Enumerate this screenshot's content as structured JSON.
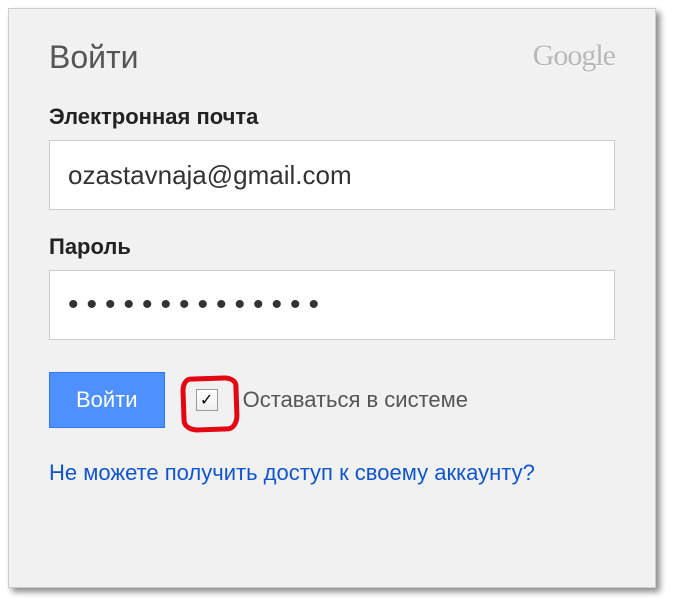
{
  "header": {
    "title": "Войти",
    "brand": "Google"
  },
  "form": {
    "email_label": "Электронная почта",
    "email_value": "ozastavnaja@gmail.com",
    "password_label": "Пароль",
    "password_value": "••••••••••••••",
    "signin_button": "Войти",
    "stay_signed_label": "Оставаться в системе",
    "checkbox_checked": "✓"
  },
  "footer": {
    "help_link": "Не можете получить доступ к своему аккаунту?"
  }
}
